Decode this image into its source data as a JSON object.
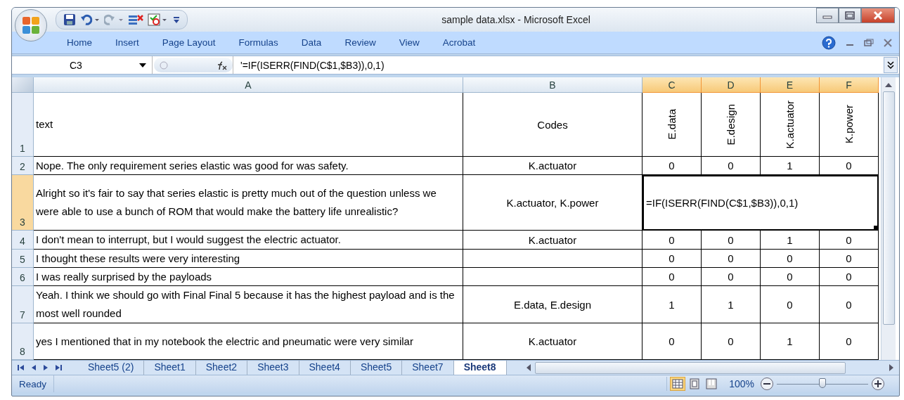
{
  "window": {
    "title": "sample data.xlsx - Microsoft Excel"
  },
  "ribbon_tabs": [
    "Home",
    "Insert",
    "Page Layout",
    "Formulas",
    "Data",
    "Review",
    "View",
    "Acrobat"
  ],
  "formula_bar": {
    "name_box": "C3",
    "formula": "'=IF(ISERR(FIND(C$1,$B3)),0,1)"
  },
  "columns": [
    {
      "label": "A",
      "selected": false
    },
    {
      "label": "B",
      "selected": false
    },
    {
      "label": "C",
      "selected": true
    },
    {
      "label": "D",
      "selected": true
    },
    {
      "label": "E",
      "selected": true
    },
    {
      "label": "F",
      "selected": true
    }
  ],
  "rows": [
    {
      "number": "1",
      "kind": "header",
      "selected": false,
      "cells": [
        "text",
        "Codes",
        "E.data",
        "E.design",
        "K.actuator",
        "K.power"
      ]
    },
    {
      "number": "2",
      "kind": "data",
      "selected": false,
      "cells": [
        "Nope.  The only requirement series elastic was good for was safety.",
        "K.actuator",
        "0",
        "0",
        "1",
        "0"
      ]
    },
    {
      "number": "3",
      "kind": "data",
      "selected": true,
      "cells": [
        "Alright so it's fair to say that series elastic is pretty much out of the question unless we were able to use a bunch of ROM that would make the battery life unrealistic?",
        "K.actuator, K.power",
        "=IF(ISERR(FIND(C$1,$B3)),0,1)"
      ]
    },
    {
      "number": "4",
      "kind": "data",
      "selected": false,
      "cells": [
        "I don't mean to interrupt, but I would suggest the electric actuator.",
        "K.actuator",
        "0",
        "0",
        "1",
        "0"
      ]
    },
    {
      "number": "5",
      "kind": "data",
      "selected": false,
      "cells": [
        "I thought these results were very interesting",
        "",
        "0",
        "0",
        "0",
        "0"
      ]
    },
    {
      "number": "6",
      "kind": "data",
      "selected": false,
      "cells": [
        "I was really surprised by the payloads",
        "",
        "0",
        "0",
        "0",
        "0"
      ]
    },
    {
      "number": "7",
      "kind": "data",
      "selected": false,
      "cells": [
        "Yeah. I think we should go with Final Final 5 because it has the highest payload and is the most well rounded",
        "E.data, E.design",
        "1",
        "1",
        "0",
        "0"
      ]
    },
    {
      "number": "8",
      "kind": "data",
      "selected": false,
      "cells": [
        "yes I mentioned that in my notebook the electric and pneumatic were very similar",
        "K.actuator",
        "0",
        "0",
        "1",
        "0"
      ]
    }
  ],
  "sheet_tabs": [
    {
      "label": "Sheet5 (2)",
      "selected": false
    },
    {
      "label": "Sheet1",
      "selected": false
    },
    {
      "label": "Sheet2",
      "selected": false
    },
    {
      "label": "Sheet3",
      "selected": false
    },
    {
      "label": "Sheet4",
      "selected": false
    },
    {
      "label": "Sheet5",
      "selected": false
    },
    {
      "label": "Sheet7",
      "selected": false
    },
    {
      "label": "Sheet8",
      "selected": true
    }
  ],
  "status_bar": {
    "status": "Ready",
    "views": [
      {
        "kind": "normal",
        "selected": true
      },
      {
        "kind": "layout",
        "selected": false
      },
      {
        "kind": "pagebreak",
        "selected": false
      }
    ],
    "zoom": "100%",
    "zoom_slider": {
      "level": 0.5
    }
  }
}
